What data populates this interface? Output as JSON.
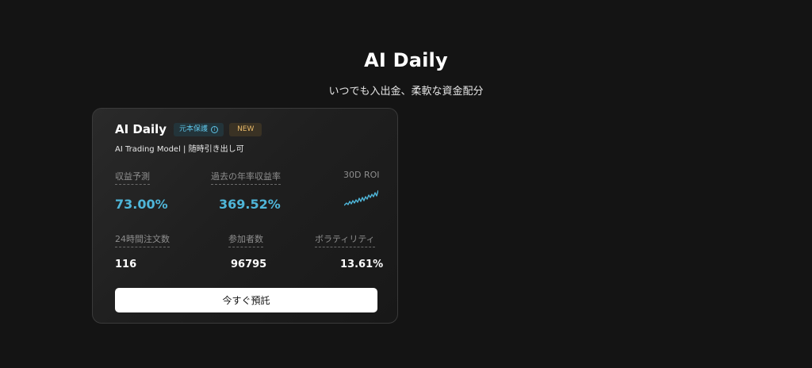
{
  "hero": {
    "title": "AI Daily",
    "subtitle": "いつでも入出金、柔軟な資金配分"
  },
  "card": {
    "title": "AI Daily",
    "tags": {
      "protect": "元本保護",
      "new": "NEW"
    },
    "description": "AI Trading Model | 随時引き出し可",
    "stats": {
      "expected_return_label": "収益予測",
      "expected_return_value": "73.00%",
      "past_apr_label": "過去の年率収益率",
      "past_apr_value": "369.52%",
      "roi_label": "30D ROI",
      "orders_24h_label": "24時間注文数",
      "orders_24h_value": "116",
      "participants_label": "参加者数",
      "participants_value": "96795",
      "volatility_label": "ボラティリティ",
      "volatility_value": "13.61%"
    },
    "cta_label": "今すぐ預託"
  },
  "colors": {
    "background": "#141414",
    "accent": "#4fb6d9",
    "tag_protect_text": "#5ec3e6",
    "tag_new_text": "#e8b969"
  }
}
